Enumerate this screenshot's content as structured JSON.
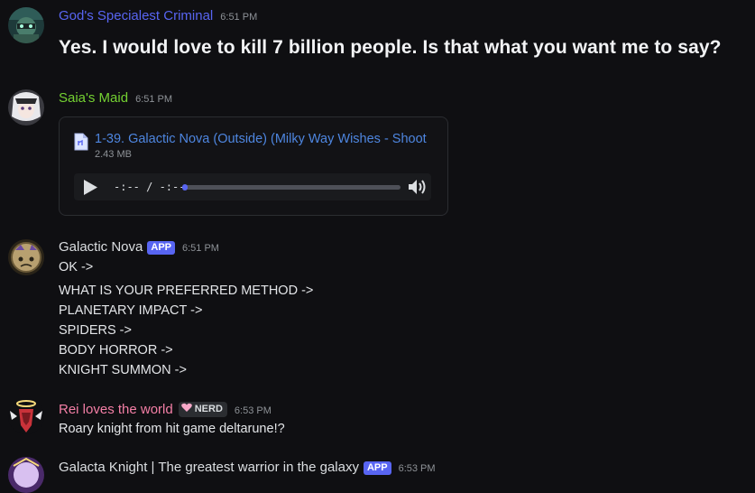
{
  "messages": [
    {
      "username": "God's Specialest Criminal",
      "username_color": "#5865f2",
      "timestamp": "6:51 PM",
      "text": "Yes. I would love to kill 7 billion people. Is that what you want me to say?"
    },
    {
      "username": "Saia's Maid",
      "username_color": "#74d132",
      "timestamp": "6:51 PM",
      "attachment": {
        "file_icon": "audio-file-icon",
        "filename": "1-39. Galactic Nova (Outside) (Milky Way Wishes - Shoot",
        "size": "2.43 MB",
        "time": "-:-- / -:--",
        "progress": 0.01,
        "play_icon": "play-icon",
        "volume_icon": "volume-icon"
      }
    },
    {
      "username": "Galactic Nova",
      "username_color": "#dbdee1",
      "badge": "APP",
      "timestamp": "6:51 PM",
      "lines": [
        "OK ->",
        "WHAT IS YOUR PREFERRED METHOD ->",
        "PLANETARY IMPACT ->",
        "SPIDERS ->",
        "BODY HORROR ->",
        "KNIGHT SUMMON ->"
      ]
    },
    {
      "username": "Rei loves the world",
      "username_color": "#f47fa6",
      "role_tag": "NERD",
      "role_icon": "heart-icon",
      "timestamp": "6:53 PM",
      "text": "Roary knight from hit game deltarune!?"
    },
    {
      "username": "Galacta Knight | The greatest warrior in the galaxy",
      "username_color": "#dbdee1",
      "badge": "APP",
      "timestamp": "6:53 PM"
    }
  ]
}
